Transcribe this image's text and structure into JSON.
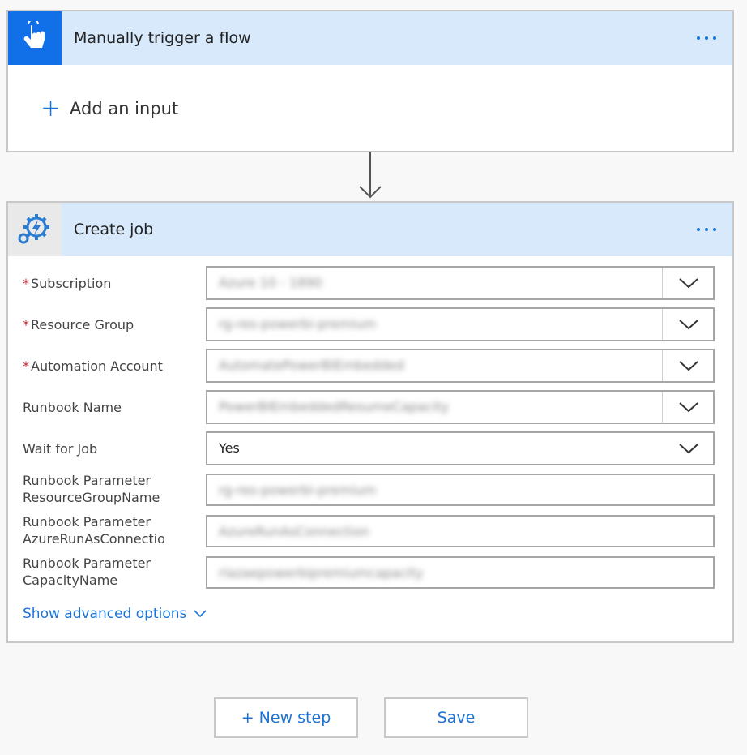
{
  "trigger": {
    "title": "Manually trigger a flow",
    "add_input_label": "Add an input"
  },
  "job": {
    "title": "Create job",
    "fields": [
      {
        "label": "Subscription",
        "required": true,
        "type": "dropdown",
        "value": "Azure 10 - 1890"
      },
      {
        "label": "Resource Group",
        "required": true,
        "type": "dropdown",
        "value": "rg-res-powerbi-premium"
      },
      {
        "label": "Automation Account",
        "required": true,
        "type": "dropdown",
        "value": "AutomatePowerBIEmbedded"
      },
      {
        "label": "Runbook Name",
        "required": false,
        "type": "dropdown",
        "value": "PowerBIEmbeddedResumeCapacity"
      },
      {
        "label": "Wait for Job",
        "required": false,
        "type": "dropdown",
        "value": "Yes"
      },
      {
        "label_line1": "Runbook Parameter",
        "label_line2": "ResourceGroupName",
        "required": false,
        "type": "text",
        "value": "rg-res-powerbi-premium"
      },
      {
        "label_line1": "Runbook Parameter",
        "label_line2": "AzureRunAsConnectio",
        "required": false,
        "type": "text",
        "value": "AzureRunAsConnection"
      },
      {
        "label_line1": "Runbook Parameter",
        "label_line2": "CapacityName",
        "required": false,
        "type": "text",
        "value": "riazaepowerbipremiumcapacity"
      }
    ],
    "advanced_label": "Show advanced options"
  },
  "buttons": {
    "new_step_label": "+ New step",
    "save_label": "Save"
  },
  "colors": {
    "accent": "#1a73d8",
    "header_bg": "#d7e9fb",
    "trigger_icon_bg": "#1170e8",
    "required": "#c4262e"
  },
  "icons": {
    "trigger": "touch-hand-icon",
    "job": "automation-gear-bolt-icon",
    "more": "more-options-icon",
    "add": "plus-icon",
    "dropdown": "chevron-down-icon"
  }
}
